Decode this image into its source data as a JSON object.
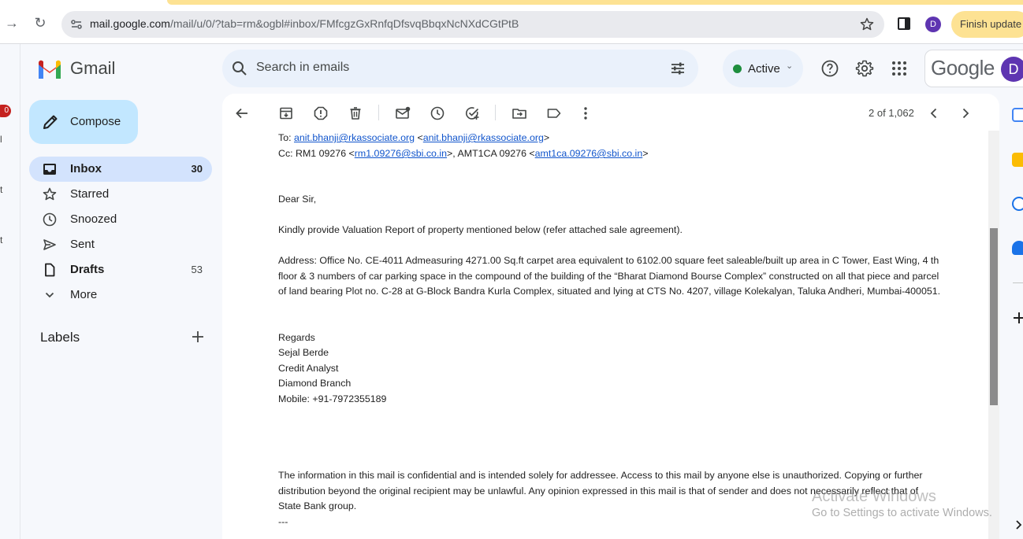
{
  "browser": {
    "url_host": "mail.google.com",
    "url_path": "/mail/u/0/?tab=rm&ogbl#inbox/FMfcgzGxRnfqDfsvqBbqxNcNXdCGtPtB",
    "avatar_letter": "D",
    "finish_update_label": "Finish update"
  },
  "left_strip": {
    "badge": "0",
    "chars": [
      "l",
      "t",
      "t"
    ]
  },
  "header": {
    "product_name": "Gmail",
    "search_placeholder": "Search in emails",
    "status_label": "Active",
    "google_wordmark": "Google",
    "account_letter": "D"
  },
  "sidebar": {
    "compose_label": "Compose",
    "items": [
      {
        "label": "Inbox",
        "count": "30"
      },
      {
        "label": "Starred",
        "count": ""
      },
      {
        "label": "Snoozed",
        "count": ""
      },
      {
        "label": "Sent",
        "count": ""
      },
      {
        "label": "Drafts",
        "count": "53"
      },
      {
        "label": "More",
        "count": ""
      }
    ],
    "labels_heading": "Labels"
  },
  "toolbar": {
    "page_count": "2 of 1,062"
  },
  "email": {
    "to_prefix": "To: ",
    "to_name": "anit.bhanji@rkassociate.org",
    "to_addr_open": " <",
    "to_addr": "anit.bhanji@rkassociate.org",
    "to_addr_close": ">",
    "cc_prefix": "Cc: RM1 09276 <",
    "cc_addr1": "rm1.09276@sbi.co.in",
    "cc_mid": ">, AMT1CA 09276 <",
    "cc_addr2": "amt1ca.09276@sbi.co.in",
    "cc_close": ">",
    "greeting": "Dear Sir,",
    "request": "Kindly provide Valuation Report of property mentioned below (refer attached sale agreement).",
    "address_lines": [
      "Address: Office No. CE-4011 Admeasuring 4271.00 Sq.ft carpet area equivalent to 6102.00 square feet saleable/built up area in C Tower, East Wing, 4 th",
      "floor & 3 numbers of car parking space in the compound of the building of the “Bharat Diamond Bourse Complex” constructed on all that piece and parcel",
      "of land bearing Plot no. C-28 at G-Block Bandra Kurla Complex, situated and lying at CTS No. 4207, village Kolekalyan, Taluka Andheri, Mumbai-400051."
    ],
    "signature": [
      "Regards",
      "Sejal Berde",
      "Credit Analyst",
      "Diamond Branch",
      "Mobile: +91-7972355189"
    ],
    "disclaimer": [
      "The information in this mail is confidential and is intended solely for addressee. Access to this mail by anyone else is unauthorized. Copying or further",
      "distribution beyond the original recipient may be unlawful. Any opinion expressed in this mail is that of sender and does not necessarily reflect that of",
      "State Bank group.",
      "---"
    ]
  },
  "watermark": {
    "line1": "Activate Windows",
    "line2": "Go to Settings to activate Windows."
  },
  "colors": {
    "accent": "#c2e7ff",
    "selected_nav": "#d3e3fd",
    "link": "#1155cc",
    "active_dot": "#1e8e3e",
    "update_pill": "#fde293"
  }
}
